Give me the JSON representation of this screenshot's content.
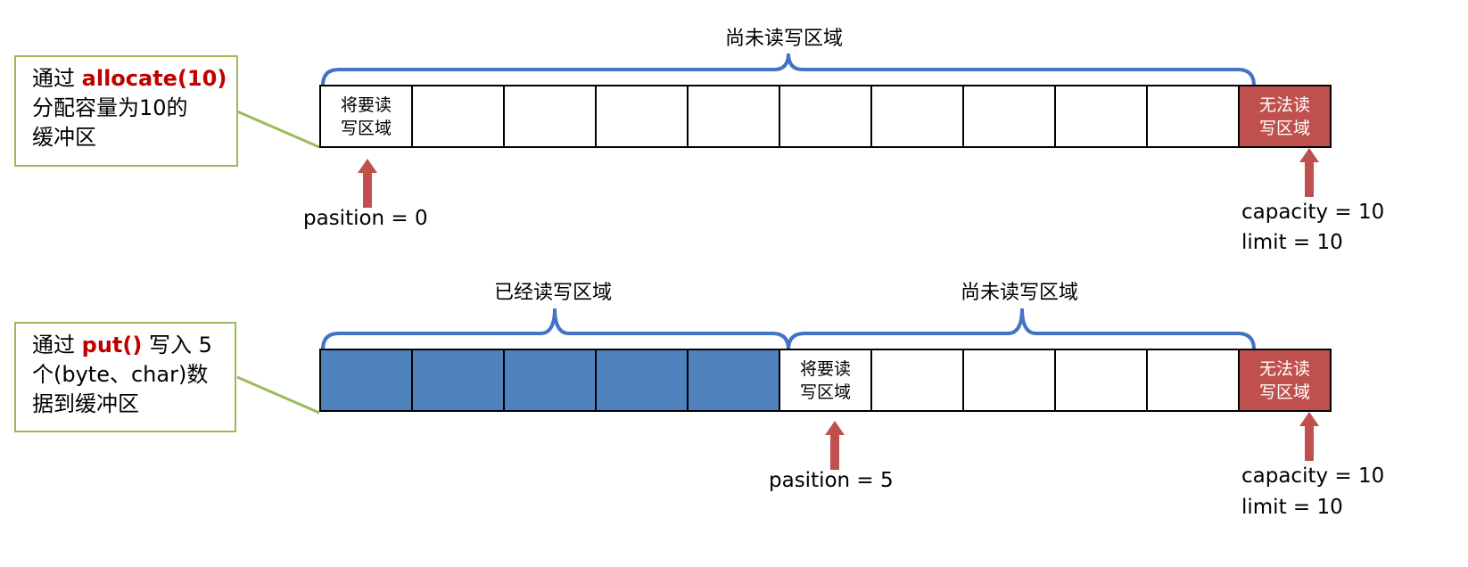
{
  "colors": {
    "filled": "#4f81bd",
    "capacity": "#c0504d",
    "brace": "#4472c4",
    "arrow": "#c0504d",
    "callout_border": "#9bbb59",
    "highlight": "#c00000"
  },
  "diagram1": {
    "callout": {
      "pre": "通过 ",
      "highlight": "allocate(10)",
      "rest": "分配容量为10的缓冲区",
      "line2": "分配容量为10的",
      "line3": "缓冲区"
    },
    "brace_label": "尚未读写区域",
    "cells": [
      "将要读\n写区域",
      "",
      "",
      "",
      "",
      "",
      "",
      "",
      "",
      "",
      "无法读\n写区域"
    ],
    "position_label": "pasition = 0",
    "capacity_label": "capacity = 10",
    "limit_label": "limit = 10"
  },
  "diagram2": {
    "callout": {
      "pre": "通过 ",
      "highlight": "put()",
      "post": " 写入 5",
      "line2": "个(byte、char)数",
      "line3": "据到缓冲区"
    },
    "brace_left_label": "已经读写区域",
    "brace_right_label": "尚未读写区域",
    "cells": [
      "",
      "",
      "",
      "",
      "",
      "将要读\n写区域",
      "",
      "",
      "",
      "",
      "无法读\n写区域"
    ],
    "position_label": "pasition = 5",
    "capacity_label": "capacity = 10",
    "limit_label": "limit = 10"
  }
}
